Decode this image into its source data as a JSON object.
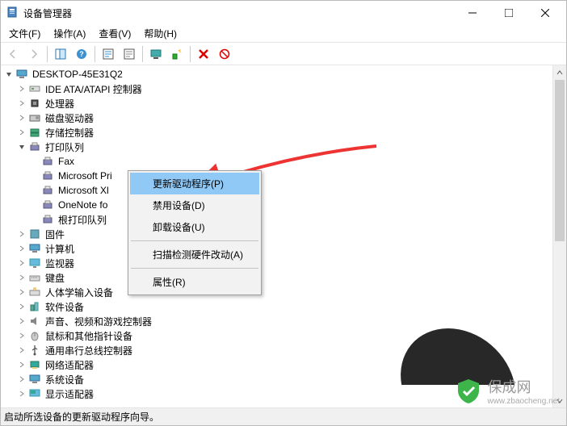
{
  "title": "设备管理器",
  "menu": {
    "file": "文件(F)",
    "action": "操作(A)",
    "view": "查看(V)",
    "help": "帮助(H)"
  },
  "root": {
    "name": "DESKTOP-45E31Q2"
  },
  "nodes": {
    "ide": "IDE ATA/ATAPI 控制器",
    "cpu": "处理器",
    "disk": "磁盘驱动器",
    "storage": "存储控制器",
    "printq": "打印队列",
    "fax": "Fax",
    "msprint": "Microsoft Pri",
    "msxl": "Microsoft Xl",
    "onenote": "OneNote fo",
    "rootprintq": "根打印队列",
    "firmware": "固件",
    "computer": "计算机",
    "monitor": "监视器",
    "keyboard": "键盘",
    "hid": "人体学输入设备",
    "software": "软件设备",
    "sound": "声音、视频和游戏控制器",
    "mouse": "鼠标和其他指针设备",
    "usb": "通用串行总线控制器",
    "net": "网络适配器",
    "system": "系统设备",
    "display": "显示适配器"
  },
  "context": {
    "update": "更新驱动程序(P)",
    "disable": "禁用设备(D)",
    "uninstall": "卸载设备(U)",
    "scan": "扫描检测硬件改动(A)",
    "properties": "属性(R)"
  },
  "status": "启动所选设备的更新驱动程序向导。",
  "watermark": {
    "name": "保成网",
    "url": "www.zbaocheng.net"
  }
}
